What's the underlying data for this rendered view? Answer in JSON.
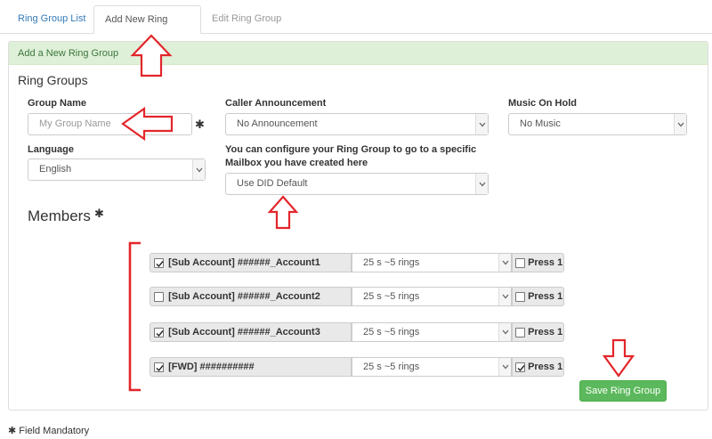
{
  "tabs": [
    {
      "label": "Ring Group List",
      "state": "link"
    },
    {
      "label": "Add New Ring Group",
      "state": "active"
    },
    {
      "label": "Edit Ring Group",
      "state": "disabled"
    }
  ],
  "panel": {
    "header": "Add a New Ring Group",
    "section_title": "Ring Groups"
  },
  "form": {
    "group_name": {
      "label": "Group Name",
      "placeholder": "My Group Name",
      "required_mark": "✱"
    },
    "caller_announcement": {
      "label": "Caller Announcement",
      "value": "No Announcement"
    },
    "music_on_hold": {
      "label": "Music On Hold",
      "value": "No Music"
    },
    "language": {
      "label": "Language",
      "value": "English"
    },
    "mailbox": {
      "label_line1": "You can configure your Ring Group to go to a specific",
      "label_line2": "Mailbox you have created here",
      "value": "Use DID Default"
    }
  },
  "members": {
    "title": "Members",
    "required_mark": "✱",
    "rows": [
      {
        "account": "[Sub Account] ######_Account1",
        "checked": true,
        "ring": "25 s ~5 rings",
        "press_label": "Press 1",
        "press_checked": false
      },
      {
        "account": "[Sub Account] ######_Account2",
        "checked": false,
        "ring": "25 s ~5 rings",
        "press_label": "Press 1",
        "press_checked": false
      },
      {
        "account": "[Sub Account] ######_Account3",
        "checked": true,
        "ring": "25 s ~5 rings",
        "press_label": "Press 1",
        "press_checked": false
      },
      {
        "account": "[FWD] ##########",
        "checked": true,
        "ring": "25 s ~5 rings",
        "press_label": "Press 1",
        "press_checked": true
      }
    ]
  },
  "save_button": "Save Ring Group",
  "footer": {
    "mark": "✱",
    "text": "Field Mandatory"
  },
  "colors": {
    "annotation_red": "#e3262b",
    "header_green_bg": "#dff0d8",
    "header_green_text": "#3c763d",
    "button_green": "#5cb85c",
    "link_blue": "#337ab7"
  },
  "icons": [
    "check-icon",
    "chevron-down-icon",
    "red-arrow-up-icon",
    "red-arrow-left-icon",
    "red-arrow-down-icon",
    "red-bracket"
  ]
}
